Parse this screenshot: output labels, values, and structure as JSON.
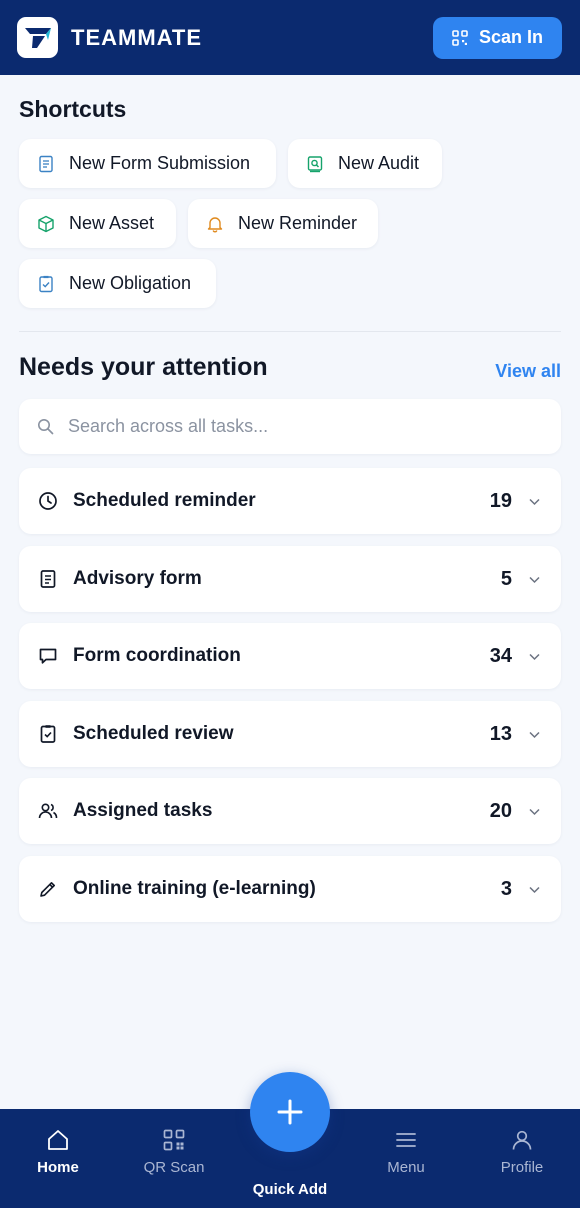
{
  "header": {
    "brand": "TEAMMATE",
    "scan_button": "Scan In"
  },
  "shortcuts": {
    "title": "Shortcuts",
    "items": [
      {
        "label": "New Form Submission",
        "icon": "document-icon"
      },
      {
        "label": "New Audit",
        "icon": "audit-search-icon"
      },
      {
        "label": "New Asset",
        "icon": "cube-icon"
      },
      {
        "label": "New Reminder",
        "icon": "bell-icon"
      },
      {
        "label": "New Obligation",
        "icon": "clipboard-check-icon"
      }
    ]
  },
  "attention": {
    "title": "Needs your attention",
    "view_all": "View all",
    "search_placeholder": "Search across all tasks...",
    "tasks": [
      {
        "label": "Scheduled reminder",
        "count": "19",
        "icon": "clock-icon"
      },
      {
        "label": "Advisory form",
        "count": "5",
        "icon": "document-icon"
      },
      {
        "label": "Form coordination",
        "count": "34",
        "icon": "chat-icon"
      },
      {
        "label": "Scheduled review",
        "count": "13",
        "icon": "clipboard-check-icon"
      },
      {
        "label": "Assigned tasks",
        "count": "20",
        "icon": "users-icon"
      },
      {
        "label": "Online training (e-learning)",
        "count": "3",
        "icon": "pencil-icon"
      }
    ]
  },
  "bottom_nav": {
    "items": [
      {
        "label": "Home",
        "icon": "home-icon",
        "active": true
      },
      {
        "label": "QR Scan",
        "icon": "qr-icon",
        "active": false
      },
      {
        "label": "Menu",
        "icon": "menu-icon",
        "active": false
      },
      {
        "label": "Profile",
        "icon": "user-icon",
        "active": false
      }
    ],
    "quick_add": "Quick Add"
  },
  "colors": {
    "brand_navy": "#0b2a6f",
    "accent_blue": "#2f84f0",
    "asset_green": "#16a36b",
    "reminder_orange": "#e08a1e",
    "form_blue": "#3b82c4"
  }
}
